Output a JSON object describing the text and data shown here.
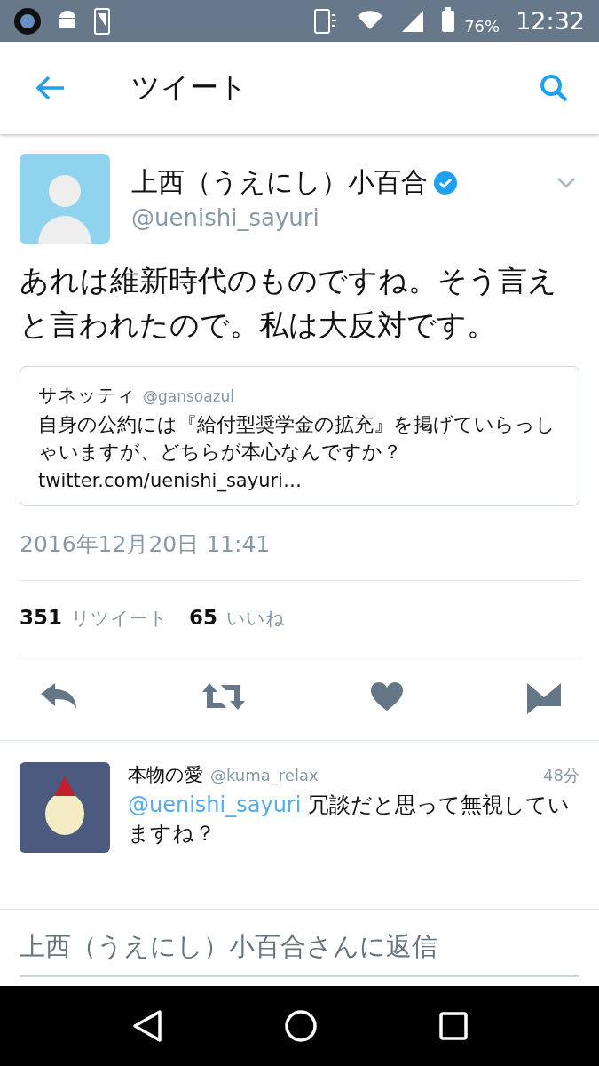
{
  "status_bar": {
    "battery": "76%",
    "time": "12:32"
  },
  "app_bar": {
    "title": "ツイート"
  },
  "tweet": {
    "name": "上西（うえにし）小百合",
    "verified": true,
    "handle": "@uenishi_sayuri",
    "text": "あれは維新時代のものですね。そう言えと言われたので。私は大反対です。",
    "quote": {
      "name": "サネッティ",
      "handle": "@gansoazul",
      "text": "自身の公約には『給付型奨学金の拡充』を掲げていらっしゃいますが、どちらが本心なんですか？",
      "link": "twitter.com/uenishi_sayuri…"
    },
    "timestamp": "2016年12月20日 11:41",
    "stats": [
      {
        "count": "351",
        "label": "リツイート"
      },
      {
        "count": "65",
        "label": "いいね"
      }
    ]
  },
  "replies": [
    {
      "name": "本物の愛",
      "handle": "@kuma_relax",
      "time": "48分",
      "mention": "@uenishi_sayuri",
      "text": "冗談だと思って無視していますね？"
    }
  ],
  "reply_field": {
    "placeholder": "上西（うえにし）小百合さんに返信"
  }
}
